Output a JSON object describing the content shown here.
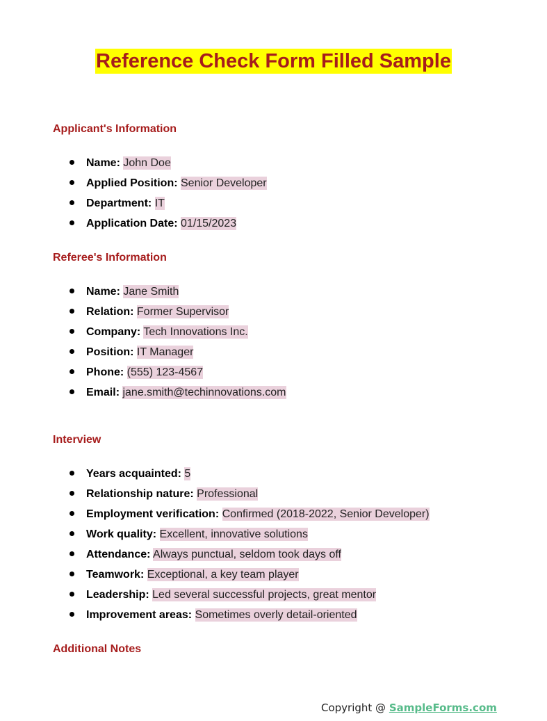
{
  "title": "Reference Check Form Filled Sample",
  "sections": {
    "applicant": {
      "heading": "Applicant's Information",
      "items": [
        {
          "label": "Name:",
          "value": "John Doe"
        },
        {
          "label": "Applied Position:",
          "value": "Senior Developer"
        },
        {
          "label": "Department:",
          "value": "IT"
        },
        {
          "label": "Application Date:",
          "value": "01/15/2023"
        }
      ]
    },
    "referee": {
      "heading": "Referee's Information",
      "items": [
        {
          "label": "Name:",
          "value": "Jane Smith"
        },
        {
          "label": "Relation:",
          "value": "Former Supervisor"
        },
        {
          "label": "Company:",
          "value": "Tech Innovations Inc."
        },
        {
          "label": "Position:",
          "value": "IT Manager"
        },
        {
          "label": "Phone:",
          "value": " (555) 123-4567"
        },
        {
          "label": "Email:",
          "value": " jane.smith@techinnovations.com"
        }
      ]
    },
    "interview": {
      "heading": "Interview",
      "items": [
        {
          "label": "Years acquainted:",
          "value": "5"
        },
        {
          "label": "Relationship nature:",
          "value": "Professional"
        },
        {
          "label": "Employment verification:",
          "value": "Confirmed (2018-2022, Senior Developer)"
        },
        {
          "label": "Work quality:",
          "value": "Excellent, innovative solutions"
        },
        {
          "label": "Attendance:",
          "value": "Always punctual, seldom took days off"
        },
        {
          "label": "Teamwork:",
          "value": "Exceptional, a key team player"
        },
        {
          "label": "Leadership:",
          "value": "Led several successful projects, great mentor"
        },
        {
          "label": "Improvement areas:",
          "value": "Sometimes overly detail-oriented"
        }
      ]
    },
    "notes": {
      "heading": "Additional Notes"
    }
  },
  "footer": {
    "prefix": "Copyright @ ",
    "link": "SampleForms.com"
  },
  "colors": {
    "title_text": "#a61c1c",
    "title_highlight": "#ffff00",
    "heading": "#a61c1c",
    "value_highlight": "#ead1dc",
    "footer_link": "#57bb8a"
  }
}
